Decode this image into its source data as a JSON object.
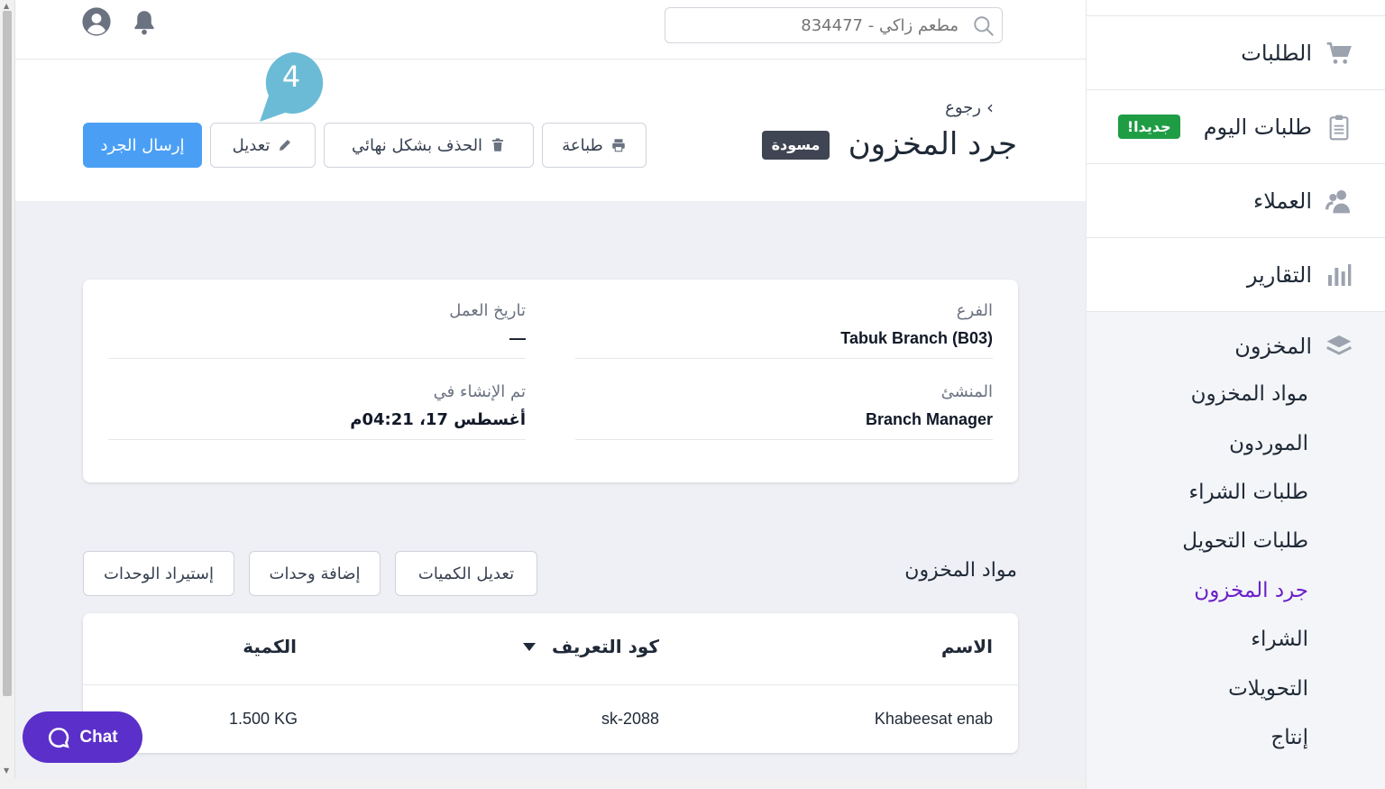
{
  "header": {
    "search_placeholder": "مطعم زاكي - 834477"
  },
  "page": {
    "back_label": "رجوع",
    "title": "جرد المخزون",
    "status_badge": "مسودة",
    "step_number": "4",
    "buttons": {
      "print": "طباعة",
      "delete_permanently": "الحذف بشكل نهائي",
      "edit": "تعديل",
      "submit": "إرسال الجرد"
    }
  },
  "details": {
    "branch_label": "الفرع",
    "branch_value": "Tabuk Branch (B03)",
    "business_date_label": "تاريخ العمل",
    "business_date_value": "—",
    "creator_label": "المنشئ",
    "creator_value": "Branch Manager",
    "created_at_label": "تم الإنشاء في",
    "created_at_value": "أغسطس 17، 04:21م"
  },
  "items_section": {
    "title": "مواد المخزون",
    "buttons": {
      "edit_quantities": "تعديل الكميات",
      "add_units": "إضافة وحدات",
      "import_units": "إستيراد الوحدات"
    },
    "columns": {
      "name": "الاسم",
      "sku": "كود التعريف",
      "quantity": "الكمية"
    },
    "rows": [
      {
        "name": "Khabeesat enab",
        "sku": "sk-2088",
        "quantity": "1.500 KG"
      }
    ]
  },
  "sidebar": {
    "items": [
      {
        "label": "الطلبات",
        "icon": "cart-icon"
      },
      {
        "label": "طلبات اليوم",
        "icon": "clipboard-icon",
        "badge": "جديدا!"
      },
      {
        "label": "العملاء",
        "icon": "users-icon"
      },
      {
        "label": "التقارير",
        "icon": "bar-chart-icon"
      }
    ],
    "inventory": {
      "label": "المخزون",
      "icon": "layers-icon",
      "sub_items": [
        "مواد المخزون",
        "الموردون",
        "طلبات الشراء",
        "طلبات التحويل",
        "جرد المخزون",
        "الشراء",
        "التحويلات",
        "إنتاج"
      ],
      "active_index": 4
    }
  },
  "chat": {
    "label": "Chat"
  },
  "colors": {
    "primary": "#4a9ff5",
    "active_nav": "#6b21c8",
    "new_badge": "#1f9d45",
    "chat": "#5b2fc9",
    "draft_badge": "#3f4552",
    "step_marker": "#6bbbd6"
  }
}
